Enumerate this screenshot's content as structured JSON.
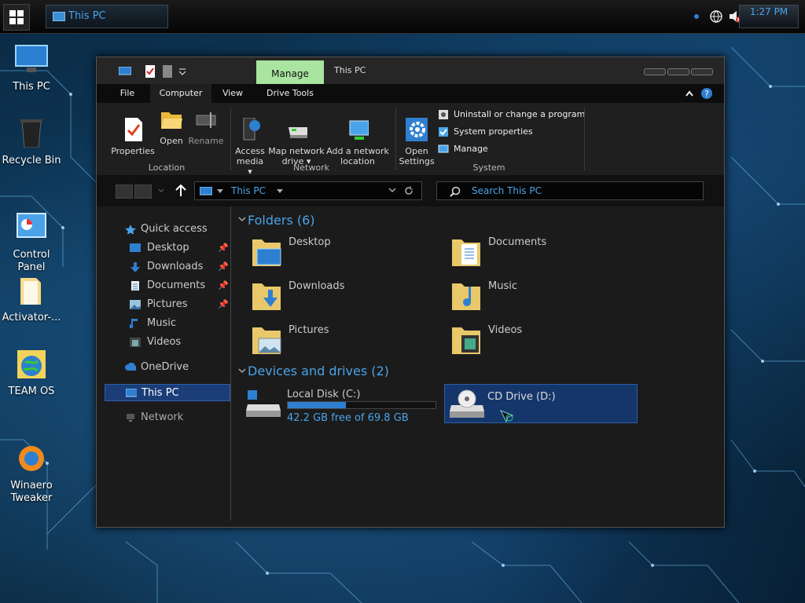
{
  "taskbar": {
    "task_label": "This PC",
    "clock": "1:27 PM"
  },
  "desktop": {
    "icons": [
      {
        "label": "This PC"
      },
      {
        "label": "Recycle Bin"
      },
      {
        "label": "Control\nPanel"
      },
      {
        "label": "Activator-..."
      },
      {
        "label": "TEAM OS"
      },
      {
        "label": "Winaero\nTweaker"
      }
    ]
  },
  "window": {
    "title": "This PC",
    "context_tab": "Manage",
    "tabs": [
      "File",
      "Computer",
      "View",
      "Drive Tools"
    ],
    "ribbon": {
      "location": {
        "label": "Location",
        "buttons": [
          "Properties",
          "Open",
          "Rename"
        ]
      },
      "network": {
        "label": "Network",
        "buttons": [
          "Access\nmedia ▾",
          "Map network\ndrive ▾",
          "Add a network\nlocation"
        ]
      },
      "system": {
        "label": "System",
        "open_settings": "Open\nSettings",
        "items": [
          "Uninstall or change a program",
          "System properties",
          "Manage"
        ]
      }
    },
    "address": {
      "path": "This PC",
      "search_placeholder": "Search This PC"
    },
    "nav": {
      "quick_access": "Quick access",
      "pinned": [
        "Desktop",
        "Downloads",
        "Documents",
        "Pictures"
      ],
      "others": [
        "Music",
        "Videos"
      ],
      "onedrive": "OneDrive",
      "this_pc": "This PC",
      "network": "Network"
    },
    "folders": {
      "heading": "Folders (6)",
      "items": [
        "Desktop",
        "Documents",
        "Downloads",
        "Music",
        "Pictures",
        "Videos"
      ]
    },
    "drives": {
      "heading": "Devices and drives (2)",
      "items": [
        {
          "name": "Local Disk (C:)",
          "free": "42.2 GB free of 69.8 GB",
          "used_fraction": 0.395
        },
        {
          "name": "CD Drive (D:)"
        }
      ]
    }
  },
  "colors": {
    "accent": "#4aa3e8",
    "manage_tab": "#a9e4a0",
    "selection": "#1b3d78"
  }
}
